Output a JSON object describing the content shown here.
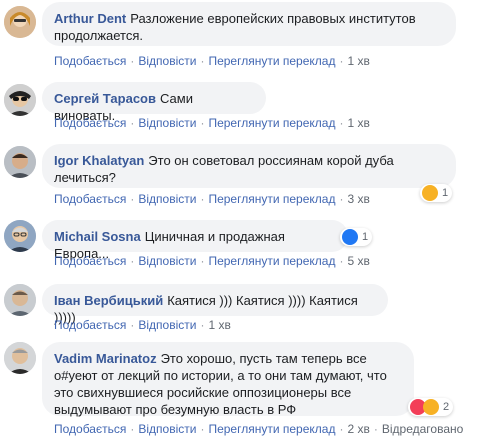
{
  "actions": {
    "like": "Подобається",
    "reply": "Відповісти",
    "see_translation": "Переглянути переклад",
    "edited": "Відредаговано"
  },
  "comments": [
    {
      "author": "Arthur Dent",
      "text": "Разложение европейских правовых институтов продолжается.",
      "time": "1 хв"
    },
    {
      "author": "Сергей Тарасов",
      "text": "Сами виноваты.",
      "time": "1 хв"
    },
    {
      "author": "Igor Khalatyan",
      "text": "Это он советовал россиянам корой дуба лечиться?",
      "time": "3 хв",
      "reactions": {
        "icons": [
          "haha-icon"
        ],
        "count": "1"
      }
    },
    {
      "author": "Michail Sosna",
      "text": "Циничная и продажная Европа...",
      "time": "5 хв",
      "reactions": {
        "icons": [
          "like-icon"
        ],
        "count": "1"
      }
    },
    {
      "author": "Іван Вербицький",
      "text": "Каятися ))) Каятися )))) Каятися )))))",
      "time": "1 хв"
    },
    {
      "author": "Vadim Marinatoz",
      "text": "Это хорошо, пусть там теперь все о#уеют от лекций по истории, а то они там думают, что это свихнувшиеся росийские оппозиционеры все выдумывают про безумную власть в РФ",
      "time": "2 хв",
      "reactions": {
        "icons": [
          "love-icon",
          "haha-icon"
        ],
        "count": "2"
      }
    }
  ]
}
